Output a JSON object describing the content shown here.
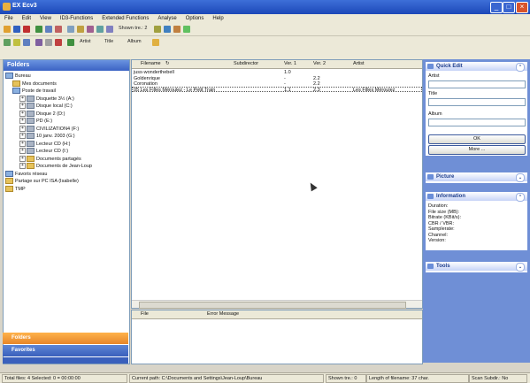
{
  "window": {
    "title": "EX Ecv3"
  },
  "menu": [
    "File",
    "Edit",
    "View",
    "ID3-Functions",
    "Extended Functions",
    "Analyse",
    "Options",
    "Help"
  ],
  "toolbar": {
    "shown_label": "Shown tre.: 2",
    "artist_label": "Artist",
    "title_label": "Title",
    "album_label": "Album"
  },
  "folders": {
    "title": "Folders",
    "tree": [
      {
        "label": "Bureau",
        "level": 0,
        "type": "pc"
      },
      {
        "label": "Mes documents",
        "level": 1,
        "type": "folder"
      },
      {
        "label": "Poste de travail",
        "level": 1,
        "type": "pc"
      },
      {
        "label": "Disquette 3½ (A:)",
        "level": 2,
        "type": "drv"
      },
      {
        "label": "Disque local (C:)",
        "level": 2,
        "type": "drv"
      },
      {
        "label": "Disque 2 (D:)",
        "level": 2,
        "type": "drv"
      },
      {
        "label": "PD (E:)",
        "level": 2,
        "type": "drv"
      },
      {
        "label": "CIVILIZATION4 (F:)",
        "level": 2,
        "type": "drv"
      },
      {
        "label": "10 janv. 2003 (G:)",
        "level": 2,
        "type": "drv"
      },
      {
        "label": "Lecteur CD (H:)",
        "level": 2,
        "type": "drv"
      },
      {
        "label": "Lecteur CD (I:)",
        "level": 2,
        "type": "drv"
      },
      {
        "label": "Documents partagés",
        "level": 2,
        "type": "folder"
      },
      {
        "label": "Documents de Jean-Loup",
        "level": 2,
        "type": "folder"
      },
      {
        "label": "Favoris réseau",
        "level": 0,
        "type": "pc"
      },
      {
        "label": "Partage sur PC ISA (Isabelle)",
        "level": 0,
        "type": "folder"
      },
      {
        "label": "TMP",
        "level": 0,
        "type": "folder"
      }
    ],
    "tabs": {
      "folders": "Folders",
      "favorites": "Favorites"
    }
  },
  "filelist": {
    "columns": [
      "Filename",
      "Subdirector",
      "Ver. 1",
      "Ver. 2",
      "Artist"
    ],
    "rows": [
      {
        "filename": "juss-wonderthebell",
        "sub": "",
        "v1": "1.0",
        "v2": "",
        "artist": ""
      },
      {
        "filename": "Goldenrique",
        "sub": "",
        "v1": "-",
        "v2": "2.2",
        "artist": ""
      },
      {
        "filename": "Coronation",
        "sub": "",
        "v1": "-",
        "v2": "2.2",
        "artist": ""
      },
      {
        "filename": "05 Les Filles Méroulez - Le Petit Train",
        "sub": "",
        "v1": "1.1",
        "v2": "2.3",
        "artist": "Les Filles Méroulez"
      }
    ]
  },
  "errors": {
    "columns": [
      "File",
      "Error Message"
    ]
  },
  "quickedit": {
    "title": "Quick Edit",
    "artist_label": "Artist",
    "title_label": "Title",
    "album_label": "Album",
    "ok": "OK",
    "more": "More ..."
  },
  "picture": {
    "title": "Picture"
  },
  "information": {
    "title": "Information",
    "lines": [
      "Duration:",
      "File size (MB):",
      "Bitrate (KBit/s):",
      "CBR / VBR:",
      "Samplerate:",
      "Channel:",
      "Version:"
    ]
  },
  "tools": {
    "title": "Tools"
  },
  "status": {
    "total": "Total files: 4  Selected: 0 = 00:00:00",
    "path": "Current path: C:\\Documents and Settings\\Jean-Loup\\Bureau",
    "shown": "Shown tre.: 0",
    "length": "Length of filename: 37 char.",
    "scan": "Scan Subdir.: No"
  },
  "colors": {
    "title_bar": "#1c48b8",
    "panel_blue": "#6f8fd6",
    "tab_orange": "#e6862a"
  }
}
